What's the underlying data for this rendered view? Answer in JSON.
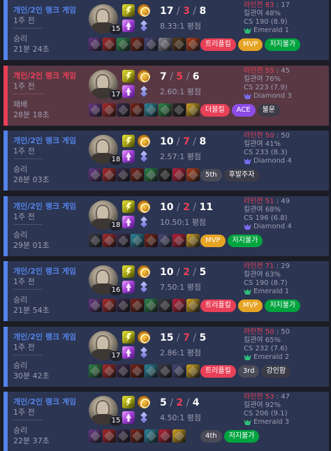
{
  "matches": [
    {
      "result_type": "win",
      "queue": "개인/2인 랭크 게임",
      "when": "1주 전",
      "result": "승리",
      "duration": "21분 24초",
      "level": "15",
      "kills": "17",
      "deaths": "3",
      "assists": "8",
      "kda_ratio": "8.33:1 평점",
      "lane_label": "라인전",
      "lane_a": "83",
      "lane_sep": " : ",
      "lane_b": "17",
      "kill_participation": "킬관여 48%",
      "cs": "CS 190 (8.9)",
      "tier": "Emerald 1",
      "tier_color": "#2dbf79",
      "items": [
        "#6b3a8a",
        "#b02a2a",
        "#2e8a4b",
        "#7a2418",
        "#4a4a7a",
        "#8a8a96",
        "#5a3a1a",
        "#b8401c"
      ],
      "badges": [
        {
          "label": "트리플킬",
          "color": "#e84057"
        },
        {
          "label": "MVP",
          "color": "#e6a424"
        },
        {
          "label": "저지불가",
          "color": "#00a43f"
        }
      ]
    },
    {
      "result_type": "loss",
      "queue": "개인/2인 랭크 게임",
      "when": "1주 전",
      "result": "패배",
      "duration": "28분 18초",
      "level": "17",
      "kills": "7",
      "deaths": "5",
      "assists": "6",
      "kda_ratio": "2.60:1 평점",
      "lane_label": "라인전",
      "lane_a": "55",
      "lane_sep": " : ",
      "lane_b": "45",
      "kill_participation": "킬관여 76%",
      "cs": "CS 223 (7.9)",
      "tier": "Diamond 3",
      "tier_color": "#7b6cf0",
      "items": [
        "#6b3a8a",
        "#b02a2a",
        "#3a2a4a",
        "#7a2418",
        "#2a8aa0",
        "#2e8a4b",
        "#2a2a2a",
        "#d8a820"
      ],
      "badges": [
        {
          "label": "더블킬",
          "color": "#e84057"
        },
        {
          "label": "ACE",
          "color": "#8b4ce6"
        },
        {
          "label": "불운",
          "color": "#3c3c48"
        }
      ]
    },
    {
      "result_type": "win",
      "queue": "개인/2인 랭크 게임",
      "when": "1주 전",
      "result": "승리",
      "duration": "28분 03초",
      "level": "18",
      "kills": "10",
      "deaths": "7",
      "assists": "8",
      "kda_ratio": "2.57:1 평점",
      "lane_label": "라인전",
      "lane_a": "50",
      "lane_sep": " : ",
      "lane_b": "50",
      "kill_participation": "킬관여 41%",
      "cs": "CS 233 (8.3)",
      "tier": "Diamond 4",
      "tier_color": "#7b6cf0",
      "items": [
        "#6b3a8a",
        "#b02a2a",
        "#3a2a4a",
        "#7a2418",
        "#2e8a4b",
        "#2a2a2a",
        "#c0203a",
        "#b8401c"
      ],
      "badges": [
        {
          "label": "5th",
          "color": "#4a4a58"
        },
        {
          "label": "후발주자",
          "color": "#3c3c48"
        }
      ]
    },
    {
      "result_type": "win",
      "queue": "개인/2인 랭크 게임",
      "when": "1주 전",
      "result": "승리",
      "duration": "29분 01초",
      "level": "18",
      "kills": "10",
      "deaths": "2",
      "assists": "11",
      "kda_ratio": "10.50:1 평점",
      "lane_label": "라인전",
      "lane_a": "51",
      "lane_sep": " : ",
      "lane_b": "49",
      "kill_participation": "킬관여 68%",
      "cs": "CS 196 (6.8)",
      "tier": "Diamond 4",
      "tier_color": "#7b6cf0",
      "items": [
        "#3a3a44",
        "#b02a2a",
        "#3a2a4a",
        "#2a8aa0",
        "#7a2418",
        "#4a4a7a",
        "#c0203a",
        "#d8a820"
      ],
      "badges": [
        {
          "label": "MVP",
          "color": "#e6a424"
        },
        {
          "label": "저지불가",
          "color": "#00a43f"
        }
      ]
    },
    {
      "result_type": "win",
      "queue": "개인/2인 랭크 게임",
      "when": "1주 전",
      "result": "승리",
      "duration": "21분 54초",
      "level": "16",
      "kills": "10",
      "deaths": "2",
      "assists": "5",
      "kda_ratio": "7.50:1 평점",
      "lane_label": "라인전",
      "lane_a": "71",
      "lane_sep": " : ",
      "lane_b": "29",
      "kill_participation": "킬관여 63%",
      "cs": "CS 190 (8.7)",
      "tier": "Emerald 1",
      "tier_color": "#2dbf79",
      "items": [
        "#6b3a8a",
        "#b02a2a",
        "#3a2a4a",
        "#7a2418",
        "#2e8a4b",
        "#3a3a44",
        "#c0203a",
        "#d8a820"
      ],
      "badges": [
        {
          "label": "트리플킬",
          "color": "#e84057"
        },
        {
          "label": "MVP",
          "color": "#e6a424"
        },
        {
          "label": "저지불가",
          "color": "#00a43f"
        }
      ]
    },
    {
      "result_type": "win",
      "queue": "개인/2인 랭크 게임",
      "when": "1주 전",
      "result": "승리",
      "duration": "30분 42초",
      "level": "17",
      "kills": "15",
      "deaths": "7",
      "assists": "5",
      "kda_ratio": "2.86:1 평점",
      "lane_label": "라인전",
      "lane_a": "50",
      "lane_sep": " : ",
      "lane_b": "50",
      "kill_participation": "킬관여 65%",
      "cs": "CS 232 (7.6)",
      "tier": "Emerald 2",
      "tier_color": "#2dbf79",
      "items": [
        "#2e8a4b",
        "#b02a2a",
        "#3a2a4a",
        "#7a2418",
        "#2a8aa0",
        "#3a3a44",
        "#4a4a7a",
        "#d8a820"
      ],
      "badges": [
        {
          "label": "트리플킬",
          "color": "#e84057"
        },
        {
          "label": "3rd",
          "color": "#4a4a58"
        },
        {
          "label": "강인함",
          "color": "#3c3c48"
        }
      ]
    },
    {
      "result_type": "win",
      "queue": "개인/2인 랭크 게임",
      "when": "1주 전",
      "result": "승리",
      "duration": "22분 37초",
      "level": "15",
      "kills": "5",
      "deaths": "2",
      "assists": "4",
      "kda_ratio": "4.50:1 평점",
      "lane_label": "라인전",
      "lane_a": "53",
      "lane_sep": " : ",
      "lane_b": "47",
      "kill_participation": "킬관여 92%",
      "cs": "CS 206 (9.1)",
      "tier": "Emerald 3",
      "tier_color": "#2dbf79",
      "items": [
        "#6b3a8a",
        "#b02a2a",
        "#3a2a4a",
        "#7a2418",
        "#2a8aa0",
        "#c0203a",
        "#d8a820"
      ],
      "badges": [
        {
          "label": "4th",
          "color": "#4a4a58"
        },
        {
          "label": "저지불가",
          "color": "#00a43f"
        }
      ]
    }
  ]
}
